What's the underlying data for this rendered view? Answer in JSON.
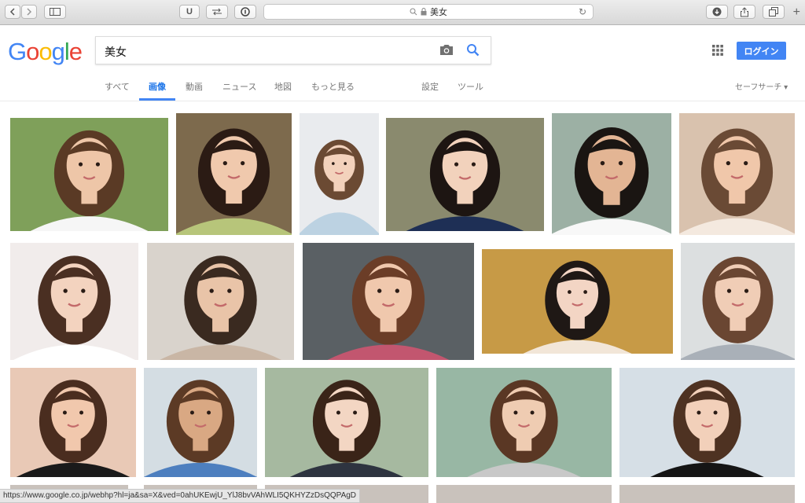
{
  "browser": {
    "address": "美女",
    "tab_u_label": "U",
    "plus": "+"
  },
  "google": {
    "logo": [
      "G",
      "o",
      "o",
      "g",
      "l",
      "e"
    ],
    "logo_colors": [
      "#4285f4",
      "#ea4335",
      "#fbbc05",
      "#4285f4",
      "#34a853",
      "#ea4335"
    ],
    "query": "美女",
    "login_label": "ログイン",
    "tabs": [
      {
        "label": "すべて"
      },
      {
        "label": "画像"
      },
      {
        "label": "動画"
      },
      {
        "label": "ニュース"
      },
      {
        "label": "地図"
      },
      {
        "label": "もっと見る"
      },
      {
        "label": "設定"
      },
      {
        "label": "ツール"
      }
    ],
    "safe_search": "セーフサーチ ▾",
    "accent": "#4285f4"
  },
  "grid": {
    "rows": [
      [
        {
          "bg": "#7fa05a",
          "skin": "#eec6a8",
          "hair": "#5a3a25",
          "cloth": "#f6f6f6"
        },
        {
          "bg": "#7d6a4d",
          "skin": "#f0c9ad",
          "hair": "#2b1b14",
          "cloth": "#b7c57a"
        },
        {
          "bg": "#e9ebee",
          "skin": "#f3d2bc",
          "hair": "#6b4a33",
          "cloth": "#bcd2e2"
        },
        {
          "bg": "#8a8a6e",
          "skin": "#f2d2bc",
          "hair": "#1d1512",
          "cloth": "#1e2f55"
        },
        {
          "bg": "#9cb0a4",
          "skin": "#e3b594",
          "hair": "#1a1512",
          "cloth": "#f8f8f8"
        },
        {
          "bg": "#d9c2ae",
          "skin": "#f0c7aa",
          "hair": "#6a4a35",
          "cloth": "#f4e9df"
        }
      ],
      [
        {
          "bg": "#f1eceb",
          "skin": "#f3d3bf",
          "hair": "#4a2f22",
          "cloth": "#ffffff"
        },
        {
          "bg": "#d9d3cc",
          "skin": "#e9c4a8",
          "hair": "#3a2a20",
          "cloth": "#c9b6a5"
        },
        {
          "bg": "#5a6064",
          "skin": "#f0c8ad",
          "hair": "#6b3d27",
          "cloth": "#c2566f"
        },
        {
          "bg": "#c79a46",
          "skin": "#f3d5c4",
          "hair": "#1f1815",
          "cloth": "#f2e6d8"
        },
        {
          "bg": "#dcdfe0",
          "skin": "#f0cdb6",
          "hair": "#6a4632",
          "cloth": "#a9b0b8"
        }
      ],
      [
        {
          "bg": "#e9c9b6",
          "skin": "#f1c8ad",
          "hair": "#4a2d1f",
          "cloth": "#1a1a1a"
        },
        {
          "bg": "#d4dde3",
          "skin": "#d9a883",
          "hair": "#5c3a25",
          "cloth": "#4d7fbf"
        },
        {
          "bg": "#a6b9a0",
          "skin": "#f3d6c3",
          "hair": "#3a2418",
          "cloth": "#2e3440"
        },
        {
          "bg": "#98b7a4",
          "skin": "#efccb2",
          "hair": "#5a3724",
          "cloth": "#c8c8c8"
        },
        {
          "bg": "#d6dfe6",
          "skin": "#f2d0ba",
          "hair": "#4e3222",
          "cloth": "#151515"
        }
      ]
    ]
  },
  "status_url": "https://www.google.co.jp/webhp?hl=ja&sa=X&ved=0ahUKEwjU_YlJ8bvVAhWLI5QKHYZzDsQQPAgD"
}
